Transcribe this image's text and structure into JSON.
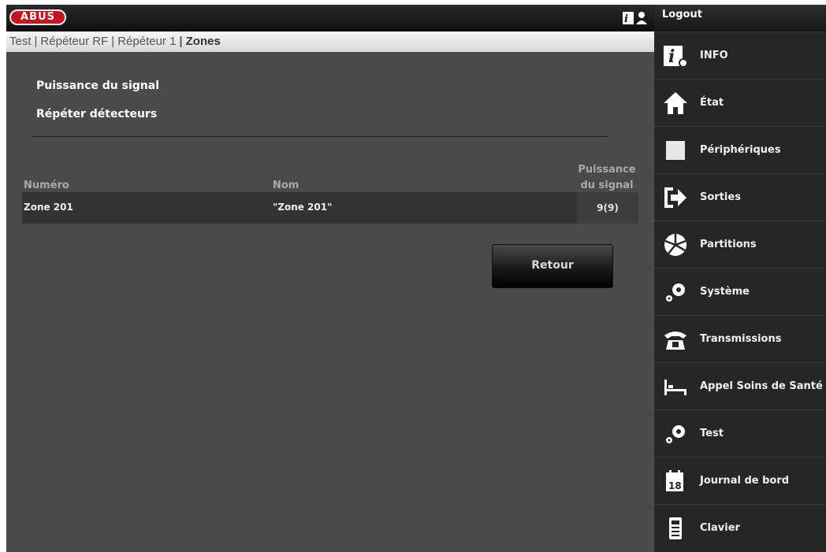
{
  "header": {
    "logo_text": "ABUS",
    "brand_color": "#c8141c"
  },
  "breadcrumb": {
    "items": [
      "Test",
      "Répéteur RF",
      "Répéteur 1"
    ],
    "current": "Zones"
  },
  "sidebar": {
    "logout": "Logout",
    "items": [
      {
        "label": "INFO",
        "icon": "info-gear-icon"
      },
      {
        "label": "État",
        "icon": "home-icon"
      },
      {
        "label": "Périphériques",
        "icon": "device-square-icon"
      },
      {
        "label": "Sorties",
        "icon": "output-arrow-icon"
      },
      {
        "label": "Partitions",
        "icon": "partitions-pie-icon"
      },
      {
        "label": "Système",
        "icon": "gears-icon"
      },
      {
        "label": "Transmissions",
        "icon": "telephone-icon"
      },
      {
        "label": "Appel Soins de Santé",
        "icon": "bed-icon"
      },
      {
        "label": "Test",
        "icon": "gears-icon"
      },
      {
        "label": "Journal de bord",
        "icon": "calendar-icon"
      },
      {
        "label": "Clavier",
        "icon": "keypad-icon"
      }
    ]
  },
  "main": {
    "links": [
      "Puissance du signal",
      "Répéter détecteurs"
    ],
    "table": {
      "headers": [
        "Numéro",
        "Nom",
        "Puissance du signal"
      ],
      "rows": [
        {
          "numero": "Zone 201",
          "nom": "\"Zone 201\"",
          "signal": "9(9)"
        }
      ]
    },
    "back_button": "Retour"
  }
}
